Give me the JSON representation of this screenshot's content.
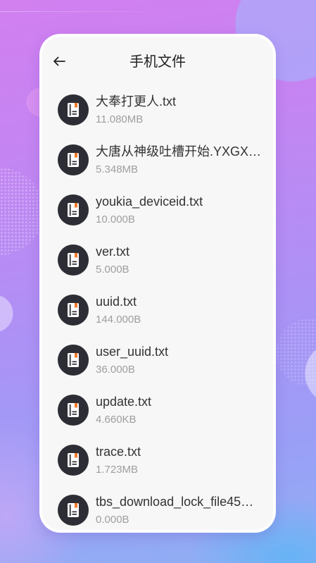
{
  "header": {
    "title": "手机文件",
    "back_icon": "arrow-left-icon"
  },
  "file_icon": "file-book-icon",
  "files": [
    {
      "name": "大奉打更人.txt",
      "size": "11.080MB"
    },
    {
      "name": "大唐从神级吐槽开始.YXGX…",
      "size": "5.348MB"
    },
    {
      "name": "youkia_deviceid.txt",
      "size": "10.000B"
    },
    {
      "name": "ver.txt",
      "size": "5.000B"
    },
    {
      "name": "uuid.txt",
      "size": "144.000B"
    },
    {
      "name": "user_uuid.txt",
      "size": "36.000B"
    },
    {
      "name": "update.txt",
      "size": "4.660KB"
    },
    {
      "name": "trace.txt",
      "size": "1.723MB"
    },
    {
      "name": "tbs_download_lock_file45…",
      "size": "0.000B"
    }
  ],
  "colors": {
    "card": "#f7f7f7",
    "icon_circle": "#2d2d35",
    "icon_accent": "#f07a2a",
    "title_text": "#333333",
    "meta_text": "#9e9e9e",
    "header_text": "#222222"
  }
}
